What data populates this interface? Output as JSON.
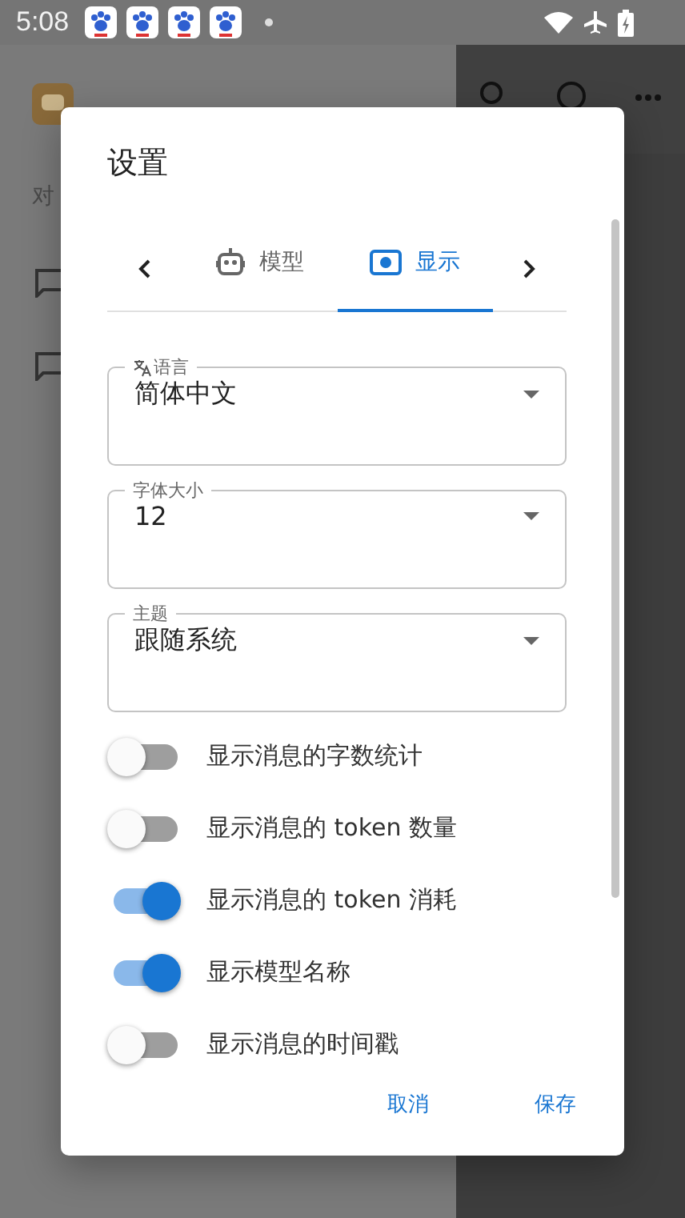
{
  "status_bar": {
    "time": "5:08"
  },
  "background": {
    "section_label": "对"
  },
  "dialog": {
    "title": "设置",
    "tabs": [
      {
        "label": "模型",
        "selected": false
      },
      {
        "label": "显示",
        "selected": true
      }
    ],
    "fields": [
      {
        "label": "语言",
        "value": "简体中文"
      },
      {
        "label": "字体大小",
        "value": "12"
      },
      {
        "label": "主题",
        "value": "跟随系统"
      }
    ],
    "switches": [
      {
        "label": "显示消息的字数统计",
        "on": false
      },
      {
        "label": "显示消息的 token 数量",
        "on": false
      },
      {
        "label": "显示消息的 token 消耗",
        "on": true
      },
      {
        "label": "显示模型名称",
        "on": true
      },
      {
        "label": "显示消息的时间戳",
        "on": false
      }
    ],
    "buttons": [
      "取消",
      "保存"
    ]
  }
}
